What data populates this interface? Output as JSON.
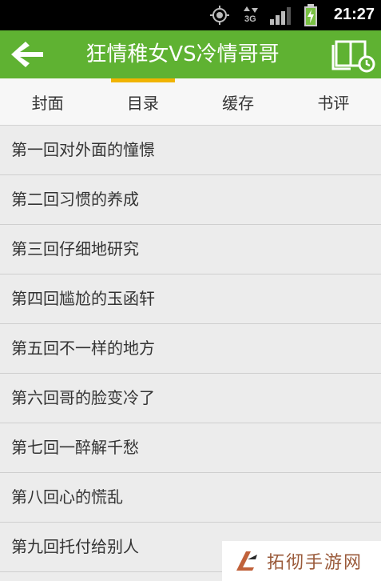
{
  "status_bar": {
    "time": "21:27",
    "network_label": "3G",
    "icons": [
      "gps-icon",
      "network-3g-icon",
      "signal-icon",
      "battery-icon"
    ]
  },
  "action_bar": {
    "title": "狂情稚女VS冷情哥哥",
    "back_icon": "arrow-left-icon",
    "bookshelf_icon": "book-clock-icon"
  },
  "tabs": [
    {
      "label": "封面",
      "active": false
    },
    {
      "label": "目录",
      "active": true
    },
    {
      "label": "缓存",
      "active": false
    },
    {
      "label": "书评",
      "active": false
    }
  ],
  "chapters": [
    "第一回对外面的憧憬",
    "第二回习惯的养成",
    "第三回仔细地研究",
    "第四回尴尬的玉函轩",
    "第五回不一样的地方",
    "第六回哥的脸变冷了",
    "第七回一醉解千愁",
    "第八回心的慌乱",
    "第九回托付给别人"
  ],
  "watermark": {
    "text": "拓彻手游网"
  },
  "colors": {
    "action_bar": "#5fb232",
    "tab_indicator": "#f0b400",
    "list_background": "#ececec"
  }
}
